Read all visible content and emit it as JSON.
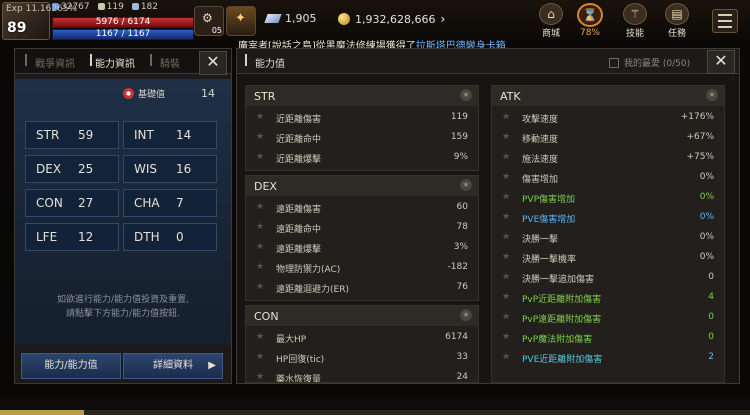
{
  "hud": {
    "level": "89",
    "stats": [
      "32767",
      "119",
      "182"
    ],
    "hp": "5976 / 6174",
    "mp": "1167 / 1167",
    "slot_count": "05",
    "gems": "1,905",
    "gold": "1,932,628,666",
    "buttons": [
      {
        "label": "商城",
        "icon": "shop-icon"
      },
      {
        "label": "78%",
        "icon": "timer-icon"
      },
      {
        "label": "技能",
        "icon": "skill-icon"
      },
      {
        "label": "任務",
        "icon": "quest-icon"
      }
    ]
  },
  "chat": {
    "text": "廣宰者[說話之島]從黑魔法修練場獲得了",
    "link": "拉斯塔巴德變身卡箱."
  },
  "left": {
    "tabs": [
      "戰爭資訊",
      "能力資訊",
      "騎裝"
    ],
    "badge_label": "基礎值",
    "badge_value": "14",
    "stats": [
      {
        "k": "STR",
        "v": "59"
      },
      {
        "k": "INT",
        "v": "14"
      },
      {
        "k": "DEX",
        "v": "25"
      },
      {
        "k": "WIS",
        "v": "16"
      },
      {
        "k": "CON",
        "v": "27"
      },
      {
        "k": "CHA",
        "v": "7"
      },
      {
        "k": "LFE",
        "v": "12"
      },
      {
        "k": "DTH",
        "v": "0"
      }
    ],
    "hint1": "如欲進行能力/能力值投資及重置,",
    "hint2": "請點擊下方能力/能力值按鈕.",
    "btn_ability": "能力/能力值",
    "btn_detail": "詳細資料"
  },
  "right": {
    "title": "能力值",
    "fav_label": "我的最愛 (0/50)",
    "sections_left": [
      {
        "title": "STR",
        "rows": [
          {
            "n": "近距離傷害",
            "v": "119"
          },
          {
            "n": "近距離命中",
            "v": "159"
          },
          {
            "n": "近距離爆擊",
            "v": "9%"
          }
        ]
      },
      {
        "title": "DEX",
        "rows": [
          {
            "n": "遠距離傷害",
            "v": "60"
          },
          {
            "n": "遠距離命中",
            "v": "78"
          },
          {
            "n": "遠距離爆擊",
            "v": "3%"
          },
          {
            "n": "物理防禦力(AC)",
            "v": "-182"
          },
          {
            "n": "遠距離迴避力(ER)",
            "v": "76"
          }
        ]
      },
      {
        "title": "CON",
        "rows": [
          {
            "n": "最大HP",
            "v": "6174"
          },
          {
            "n": "HP回復(tic)",
            "v": "33"
          },
          {
            "n": "藥水恢復量",
            "v": "24"
          }
        ]
      }
    ],
    "atk": {
      "title": "ATK",
      "rows": [
        {
          "n": "攻擊速度",
          "v": "+176%",
          "c": ""
        },
        {
          "n": "移動速度",
          "v": "+67%",
          "c": ""
        },
        {
          "n": "施法速度",
          "v": "+75%",
          "c": ""
        },
        {
          "n": "傷害增加",
          "v": "0%",
          "c": ""
        },
        {
          "n": "PVP傷害增加",
          "v": "0%",
          "c": "green"
        },
        {
          "n": "PVE傷害增加",
          "v": "0%",
          "c": "blue"
        },
        {
          "n": "決勝一擊",
          "v": "0%",
          "c": ""
        },
        {
          "n": "決勝一擊機率",
          "v": "0%",
          "c": ""
        },
        {
          "n": "決勝一擊追加傷害",
          "v": "0",
          "c": ""
        },
        {
          "n": "PvP近距離附加傷害",
          "v": "4",
          "c": "green"
        },
        {
          "n": "PvP遠距離附加傷害",
          "v": "0",
          "c": "green"
        },
        {
          "n": "PvP魔法附加傷害",
          "v": "0",
          "c": "green"
        },
        {
          "n": "PVE近距離附加傷害",
          "v": "2",
          "c": "cyan"
        }
      ]
    }
  },
  "bottom": {
    "exp": "Exp 11.16265%",
    "exp_fraction": 0.1116
  }
}
